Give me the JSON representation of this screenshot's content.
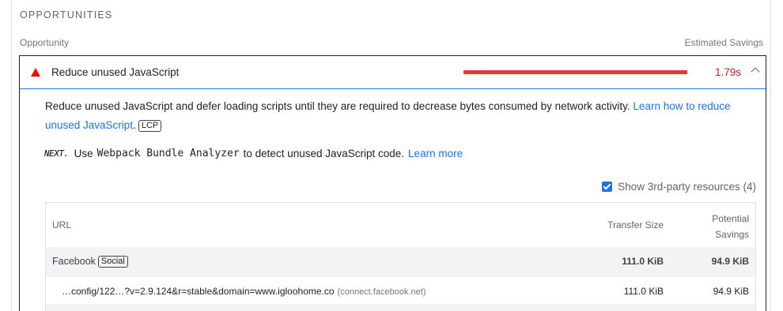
{
  "section": {
    "title": "OPPORTUNITIES",
    "col_opportunity": "Opportunity",
    "col_savings": "Estimated Savings"
  },
  "audit": {
    "title": "Reduce unused JavaScript",
    "savings": "1.79s",
    "status_color": "#eb0f00",
    "description": "Reduce unused JavaScript and defer loading scripts until they are required to decrease bytes consumed by network activity.",
    "learn_link": "Learn how to reduce unused JavaScript",
    "tag": "LCP",
    "stack_logo": "NEXT.",
    "stack_pre": "Use",
    "stack_tool": "Webpack Bundle Analyzer",
    "stack_post": "to detect unused JavaScript code.",
    "stack_link": "Learn more",
    "third_party_label": "Show 3rd-party resources (4)",
    "third_party_checked": true
  },
  "table": {
    "headers": {
      "url": "URL",
      "transfer": "Transfer Size",
      "potential_line1": "Potential",
      "potential_line2": "Savings"
    },
    "group": {
      "name": "Facebook",
      "badge": "Social",
      "transfer": "111.0 KiB",
      "savings": "94.9 KiB"
    },
    "rows": [
      {
        "url": "…config/122…?v=2.9.124&r=stable&domain=www.igloohome.co",
        "host": "(connect.facebook.net)",
        "transfer": "111.0 KiB",
        "savings": "94.9 KiB"
      }
    ]
  }
}
